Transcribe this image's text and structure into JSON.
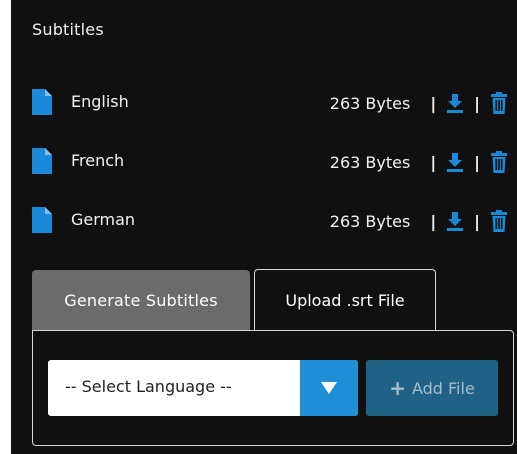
{
  "panel": {
    "title": "Subtitles"
  },
  "subtitles": [
    {
      "language": "English",
      "size": "263 Bytes"
    },
    {
      "language": "French",
      "size": "263 Bytes"
    },
    {
      "language": "German",
      "size": "263 Bytes"
    }
  ],
  "separator": "|",
  "tabs": {
    "generate_label": "Generate Subtitles",
    "upload_label": "Upload .srt File"
  },
  "form": {
    "select_value": "-- Select Language --",
    "add_file_label": "Add File",
    "add_file_glyph": "+"
  },
  "colors": {
    "panel_bg": "#101010",
    "accent_blue": "#1e8fd6",
    "icon_blue": "#1a8ad8",
    "active_tab_bg": "#6b6b6b",
    "disabled_button_bg": "#1f6286"
  }
}
